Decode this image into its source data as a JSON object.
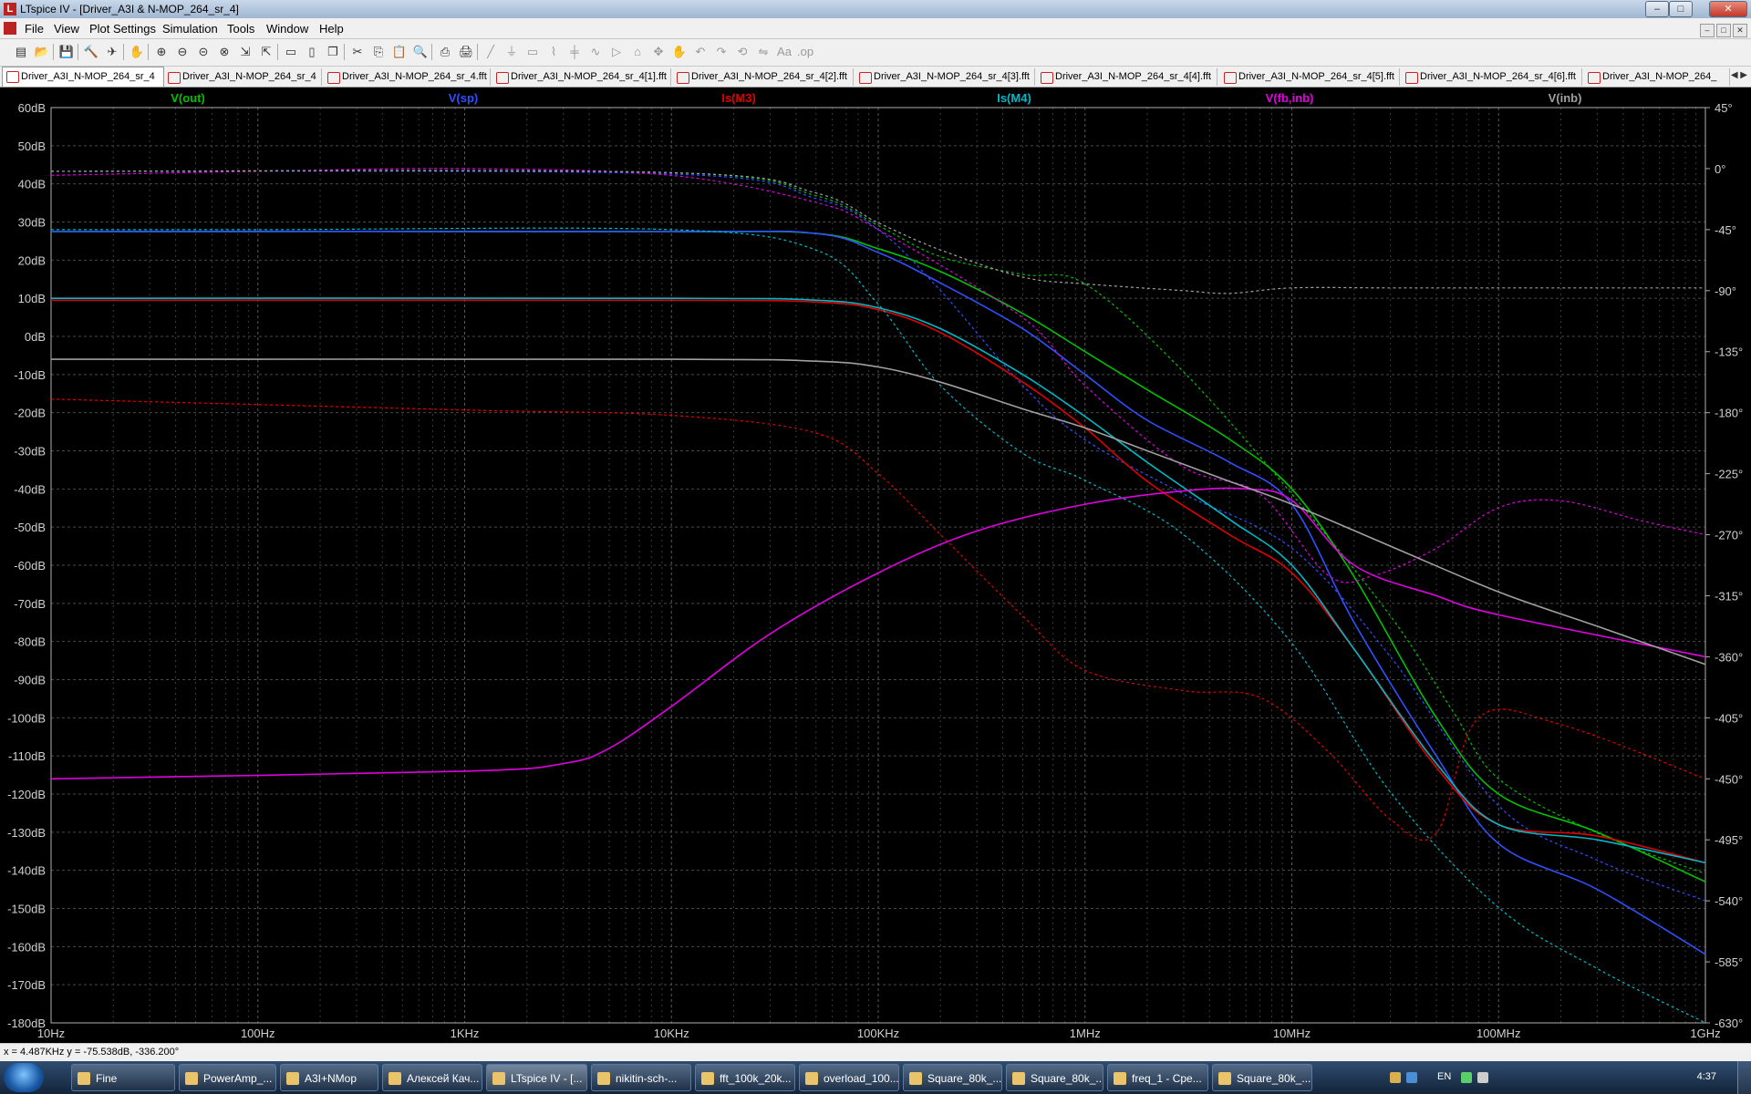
{
  "window": {
    "title": "LTspice IV - [Driver_A3I & N-MOP_264_sr_4]"
  },
  "window_buttons": {
    "minimize": "–",
    "maximize": "□",
    "close": "✕"
  },
  "menu": [
    "File",
    "View",
    "Plot Settings",
    "Simulation",
    "Tools",
    "Window",
    "Help"
  ],
  "toolbar": {
    "icons": [
      "new-schematic-icon",
      "open-icon",
      "save-icon",
      "control-panel-icon",
      "run-icon",
      "halt-icon",
      "zoom-in-icon",
      "zoom-out-icon",
      "zoom-back-icon",
      "zoom-full-icon",
      "autorange-icon",
      "zoom-cancel-icon",
      "tile-horizontal-icon",
      "tile-vertical-icon",
      "cascade-icon",
      "cut-icon",
      "copy-icon",
      "paste-icon",
      "find-icon",
      "print-preview-icon",
      "print-icon",
      "wire-icon",
      "ground-icon",
      "label-icon",
      "resistor-icon",
      "capacitor-icon",
      "inductor-icon",
      "diode-icon",
      "component-icon",
      "move-icon",
      "drag-icon",
      "undo-icon",
      "redo-icon",
      "rotate-icon",
      "mirror-icon",
      "text-icon",
      "spice-directive-icon"
    ]
  },
  "tabs": [
    "Driver_A3I_N-MOP_264_sr_4",
    "Driver_A3I_N-MOP_264_sr_4",
    "Driver_A3I_N-MOP_264_sr_4.fft",
    "Driver_A3I_N-MOP_264_sr_4[1].fft",
    "Driver_A3I_N-MOP_264_sr_4[2].fft",
    "Driver_A3I_N-MOP_264_sr_4[3].fft",
    "Driver_A3I_N-MOP_264_sr_4[4].fft",
    "Driver_A3I_N-MOP_264_sr_4[5].fft",
    "Driver_A3I_N-MOP_264_sr_4[6].fft",
    "Driver_A3I_N-MOP_264_"
  ],
  "chart_data": {
    "type": "line",
    "x_scale": "log",
    "xlim": [
      10,
      1000000000
    ],
    "ylim": [
      -180,
      60
    ],
    "phase_lim": [
      -630,
      45
    ],
    "grid": true,
    "x_ticks": [
      "10Hz",
      "100Hz",
      "1KHz",
      "10KHz",
      "100KHz",
      "1MHz",
      "10MHz",
      "100MHz",
      "1GHz"
    ],
    "y_ticks": [
      "60dB",
      "50dB",
      "40dB",
      "30dB",
      "20dB",
      "10dB",
      "0dB",
      "-10dB",
      "-20dB",
      "-30dB",
      "-40dB",
      "-50dB",
      "-60dB",
      "-70dB",
      "-80dB",
      "-90dB",
      "-100dB",
      "-110dB",
      "-120dB",
      "-130dB",
      "-140dB",
      "-150dB",
      "-160dB",
      "-170dB",
      "-180dB"
    ],
    "phase_ticks": [
      "45°",
      "0°",
      "-45°",
      "-90°",
      "-135°",
      "-180°",
      "-225°",
      "-270°",
      "-315°",
      "-360°",
      "-405°",
      "-450°",
      "-495°",
      "-540°",
      "-585°",
      "-630°"
    ],
    "legend": [
      {
        "name": "V(out)",
        "color": "#00c000"
      },
      {
        "name": "V(sp)",
        "color": "#3050ff"
      },
      {
        "name": "Is(M3)",
        "color": "#e00000"
      },
      {
        "name": "Is(M4)",
        "color": "#00b8c8"
      },
      {
        "name": "V(fb,inb)",
        "color": "#e000e0"
      },
      {
        "name": "V(inb)",
        "color": "#a0a0a0"
      }
    ],
    "series": [
      {
        "color": "#00c000",
        "kind": "mag",
        "points": [
          [
            10,
            27.5
          ],
          [
            10000,
            27.5
          ],
          [
            50000,
            27
          ],
          [
            100000,
            23
          ],
          [
            200000,
            17
          ],
          [
            500000,
            6
          ],
          [
            1000000,
            -4
          ],
          [
            2000000,
            -14
          ],
          [
            5000000,
            -27
          ],
          [
            10000000,
            -40
          ],
          [
            20000000,
            -63
          ],
          [
            50000000,
            -100
          ],
          [
            100000000,
            -120
          ],
          [
            300000000,
            -130
          ],
          [
            1000000000,
            -143
          ]
        ]
      },
      {
        "color": "#00c000",
        "kind": "phase",
        "points": [
          [
            10,
            -2
          ],
          [
            10000,
            -3
          ],
          [
            50000,
            -20
          ],
          [
            100000,
            -42
          ],
          [
            200000,
            -65
          ],
          [
            500000,
            -78
          ],
          [
            1000000,
            -85
          ],
          [
            3000000,
            -150
          ],
          [
            10000000,
            -240
          ],
          [
            30000000,
            -330
          ],
          [
            60000000,
            -400
          ],
          [
            100000000,
            -450
          ],
          [
            300000000,
            -490
          ],
          [
            1000000000,
            -520
          ]
        ]
      },
      {
        "color": "#3050ff",
        "kind": "mag",
        "points": [
          [
            10,
            27.5
          ],
          [
            10000,
            27.5
          ],
          [
            50000,
            27
          ],
          [
            100000,
            22
          ],
          [
            200000,
            14
          ],
          [
            500000,
            2
          ],
          [
            1000000,
            -10
          ],
          [
            2000000,
            -22
          ],
          [
            5000000,
            -33
          ],
          [
            10000000,
            -44
          ],
          [
            20000000,
            -75
          ],
          [
            50000000,
            -110
          ],
          [
            100000000,
            -133
          ],
          [
            300000000,
            -145
          ],
          [
            1000000000,
            -162
          ]
        ]
      },
      {
        "color": "#3050ff",
        "kind": "phase",
        "points": [
          [
            10,
            -2
          ],
          [
            10000,
            -4
          ],
          [
            50000,
            -22
          ],
          [
            100000,
            -45
          ],
          [
            200000,
            -90
          ],
          [
            500000,
            -160
          ],
          [
            1000000,
            -200
          ],
          [
            3000000,
            -240
          ],
          [
            10000000,
            -280
          ],
          [
            30000000,
            -360
          ],
          [
            100000000,
            -470
          ],
          [
            300000000,
            -510
          ],
          [
            1000000000,
            -540
          ]
        ]
      },
      {
        "color": "#e00000",
        "kind": "mag",
        "points": [
          [
            10,
            9.5
          ],
          [
            10000,
            9.5
          ],
          [
            50000,
            9
          ],
          [
            100000,
            7
          ],
          [
            200000,
            1
          ],
          [
            500000,
            -12
          ],
          [
            1000000,
            -24
          ],
          [
            2000000,
            -38
          ],
          [
            5000000,
            -52
          ],
          [
            10000000,
            -62
          ],
          [
            20000000,
            -82
          ],
          [
            50000000,
            -113
          ],
          [
            100000000,
            -128
          ],
          [
            300000000,
            -131
          ],
          [
            1000000000,
            -138
          ]
        ]
      },
      {
        "color": "#e00000",
        "kind": "phase",
        "points": [
          [
            10,
            -170
          ],
          [
            1000,
            -178
          ],
          [
            10000,
            -182
          ],
          [
            50000,
            -195
          ],
          [
            100000,
            -225
          ],
          [
            200000,
            -270
          ],
          [
            500000,
            -330
          ],
          [
            1000000,
            -370
          ],
          [
            3000000,
            -385
          ],
          [
            7000000,
            -390
          ],
          [
            15000000,
            -430
          ],
          [
            30000000,
            -480
          ],
          [
            50000000,
            -490
          ],
          [
            80000000,
            -405
          ],
          [
            200000000,
            -410
          ],
          [
            1000000000,
            -450
          ]
        ]
      },
      {
        "color": "#00b8c8",
        "kind": "mag",
        "points": [
          [
            10,
            10
          ],
          [
            10000,
            10
          ],
          [
            50000,
            9.5
          ],
          [
            100000,
            7.5
          ],
          [
            200000,
            2
          ],
          [
            500000,
            -10
          ],
          [
            1000000,
            -21
          ],
          [
            2000000,
            -33
          ],
          [
            5000000,
            -48
          ],
          [
            10000000,
            -60
          ],
          [
            20000000,
            -82
          ],
          [
            50000000,
            -112
          ],
          [
            100000000,
            -128
          ],
          [
            300000000,
            -132
          ],
          [
            1000000000,
            -138
          ]
        ]
      },
      {
        "color": "#00b8c8",
        "kind": "phase",
        "points": [
          [
            10,
            -45
          ],
          [
            100,
            -45
          ],
          [
            10000,
            -45
          ],
          [
            50000,
            -60
          ],
          [
            100000,
            -100
          ],
          [
            200000,
            -160
          ],
          [
            500000,
            -210
          ],
          [
            1000000,
            -230
          ],
          [
            3000000,
            -270
          ],
          [
            10000000,
            -350
          ],
          [
            30000000,
            -460
          ],
          [
            100000000,
            -545
          ],
          [
            300000000,
            -590
          ],
          [
            1000000000,
            -630
          ]
        ]
      },
      {
        "color": "#e000e0",
        "kind": "mag",
        "points": [
          [
            10,
            -116
          ],
          [
            1000,
            -114
          ],
          [
            3000,
            -112
          ],
          [
            5000,
            -108
          ],
          [
            10000,
            -97
          ],
          [
            30000,
            -78
          ],
          [
            100000,
            -62
          ],
          [
            300000,
            -51
          ],
          [
            1000000,
            -44
          ],
          [
            3000000,
            -40.5
          ],
          [
            6000000,
            -40
          ],
          [
            10000000,
            -43
          ],
          [
            20000000,
            -60
          ],
          [
            50000000,
            -68
          ],
          [
            100000000,
            -73
          ],
          [
            1000000000,
            -84
          ]
        ]
      },
      {
        "color": "#e000e0",
        "kind": "phase",
        "points": [
          [
            10,
            -5
          ],
          [
            100,
            -2
          ],
          [
            1000,
            0
          ],
          [
            10000,
            -5
          ],
          [
            50000,
            -25
          ],
          [
            100000,
            -45
          ],
          [
            500000,
            -110
          ],
          [
            1000000,
            -160
          ],
          [
            3000000,
            -220
          ],
          [
            7000000,
            -240
          ],
          [
            15000000,
            -300
          ],
          [
            25000000,
            -300
          ],
          [
            50000000,
            -280
          ],
          [
            100000000,
            -250
          ],
          [
            200000000,
            -245
          ],
          [
            500000000,
            -260
          ],
          [
            1000000000,
            -270
          ]
        ]
      },
      {
        "color": "#a0a0a0",
        "kind": "mag",
        "points": [
          [
            10,
            -6
          ],
          [
            10000,
            -6
          ],
          [
            50000,
            -6.5
          ],
          [
            100000,
            -8
          ],
          [
            200000,
            -12
          ],
          [
            500000,
            -19
          ],
          [
            1000000,
            -24
          ],
          [
            2000000,
            -30
          ],
          [
            5000000,
            -38
          ],
          [
            10000000,
            -44
          ],
          [
            30000000,
            -55
          ],
          [
            100000000,
            -67
          ],
          [
            300000000,
            -76
          ],
          [
            1000000000,
            -86
          ]
        ]
      },
      {
        "color": "#a0a0a0",
        "kind": "phase",
        "points": [
          [
            10,
            -2
          ],
          [
            10000,
            -3
          ],
          [
            50000,
            -18
          ],
          [
            100000,
            -40
          ],
          [
            200000,
            -60
          ],
          [
            500000,
            -80
          ],
          [
            1000000,
            -85
          ],
          [
            3000000,
            -90
          ],
          [
            5000000,
            -92
          ],
          [
            10000000,
            -88
          ],
          [
            30000000,
            -88
          ],
          [
            100000000,
            -88
          ],
          [
            1000000000,
            -88
          ]
        ]
      }
    ]
  },
  "status": {
    "cursor": "x = 4.487KHz    y = -75.538dB, -336.200°"
  },
  "taskbar": {
    "items": [
      "Fine",
      "PowerAmp_...",
      "A3I+NMop",
      "Алексей Кач...",
      "LTspice IV - [...",
      "nikitin-sch-...",
      "fft_100k_20k...",
      "overload_100...",
      "Square_80k_...",
      "Square_80k_...",
      "freq_1 - Сре...",
      "Square_80k_..."
    ],
    "lang": "EN",
    "clock": "4:37"
  }
}
